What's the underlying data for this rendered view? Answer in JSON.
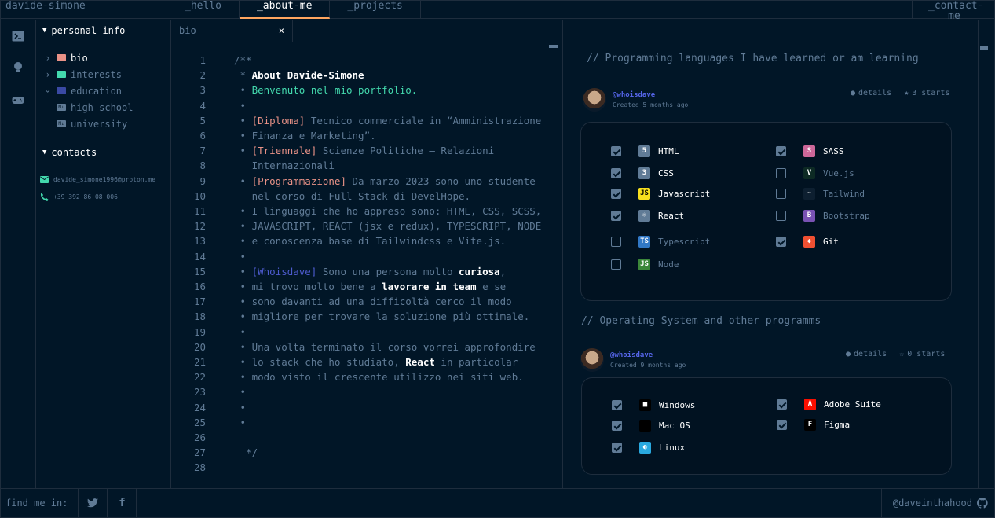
{
  "header": {
    "brand": "davide-simone",
    "tabs": [
      "_hello",
      "_about-me",
      "_projects"
    ],
    "active_tab": "_about-me",
    "contact": "_contact-me"
  },
  "sidebar": {
    "section_title": "personal-info",
    "items": [
      {
        "label": "bio",
        "type": "folder",
        "color": "#e99287",
        "active": true
      },
      {
        "label": "interests",
        "type": "folder",
        "color": "#43d9ad"
      },
      {
        "label": "education",
        "type": "folder",
        "color": "#3a49a4",
        "open": true
      },
      {
        "label": "high-school",
        "type": "file"
      },
      {
        "label": "university",
        "type": "file"
      }
    ],
    "contacts_title": "contacts",
    "email": "davide_simone1996@proton.me",
    "phone": "+39 392 86 08 006"
  },
  "editor": {
    "tab": "bio",
    "close": "×",
    "line_numbers": [
      "1",
      "2",
      "3",
      "4",
      "5",
      "6",
      "7",
      "8",
      "9",
      "10",
      "11",
      "12",
      "13",
      "14",
      "15",
      "16",
      "17",
      "18",
      "19",
      "20",
      "21",
      "22",
      "23",
      "24",
      "25",
      "26",
      "27",
      "28"
    ],
    "lines": [
      {
        "parts": [
          {
            "t": "/**"
          }
        ]
      },
      {
        "parts": [
          {
            "t": " * "
          },
          {
            "t": "About Davide-Simone",
            "c": "wb"
          }
        ]
      },
      {
        "parts": [
          {
            "t": " • "
          },
          {
            "t": "Benvenuto nel mio portfolio.",
            "c": "gr"
          }
        ]
      },
      {
        "parts": [
          {
            "t": " •"
          }
        ]
      },
      {
        "parts": [
          {
            "t": " • "
          },
          {
            "t": "[Diploma]",
            "c": "kw"
          },
          {
            "t": " Tecnico commerciale in “Amministrazione"
          }
        ]
      },
      {
        "parts": [
          {
            "t": " • Finanza e Marketing”."
          }
        ]
      },
      {
        "parts": [
          {
            "t": " • "
          },
          {
            "t": "[Triennale]",
            "c": "kw"
          },
          {
            "t": " Scienze Politiche – Relazioni"
          }
        ]
      },
      {
        "parts": [
          {
            "t": "   Internazionali"
          }
        ]
      },
      {
        "parts": [
          {
            "t": " • "
          },
          {
            "t": "[Programmazione]",
            "c": "kw"
          },
          {
            "t": " Da marzo 2023 sono uno studente"
          }
        ]
      },
      {
        "parts": [
          {
            "t": "   nel corso di Full Stack di DevelHope."
          }
        ]
      },
      {
        "parts": [
          {
            "t": " • I linguaggi che ho appreso sono: HTML, CSS, SCSS,"
          }
        ]
      },
      {
        "parts": [
          {
            "t": " • JAVASCRIPT, REACT (jsx e redux), TYPESCRIPT, NODE"
          }
        ]
      },
      {
        "parts": [
          {
            "t": " • e conoscenza base di Tailwindcss e Vite.js."
          }
        ]
      },
      {
        "parts": [
          {
            "t": " •"
          }
        ]
      },
      {
        "parts": [
          {
            "t": " • "
          },
          {
            "t": "[Whoisdave]",
            "c": "bl"
          },
          {
            "t": " Sono una persona molto "
          },
          {
            "t": "curiosa",
            "c": "wb"
          },
          {
            "t": ","
          }
        ]
      },
      {
        "parts": [
          {
            "t": " • mi trovo molto bene a "
          },
          {
            "t": "lavorare in team",
            "c": "wb"
          },
          {
            "t": " e se"
          }
        ]
      },
      {
        "parts": [
          {
            "t": " • sono davanti ad una difficoltà cerco il modo"
          }
        ]
      },
      {
        "parts": [
          {
            "t": " • migliore per trovare la soluzione più ottimale."
          }
        ]
      },
      {
        "parts": [
          {
            "t": " •"
          }
        ]
      },
      {
        "parts": [
          {
            "t": " • Una volta terminato il corso vorrei approfondire"
          }
        ]
      },
      {
        "parts": [
          {
            "t": " • lo stack che ho studiato, "
          },
          {
            "t": "React",
            "c": "wb"
          },
          {
            "t": " in particolar"
          }
        ]
      },
      {
        "parts": [
          {
            "t": " • modo visto il crescente utilizzo nei siti web."
          }
        ]
      },
      {
        "parts": [
          {
            "t": " •"
          }
        ]
      },
      {
        "parts": [
          {
            "t": " •"
          }
        ]
      },
      {
        "parts": [
          {
            "t": " •"
          }
        ]
      },
      {
        "parts": [
          {
            "t": ""
          }
        ]
      },
      {
        "parts": [
          {
            "t": "  */"
          }
        ]
      },
      {
        "parts": [
          {
            "t": ""
          }
        ]
      }
    ]
  },
  "right": {
    "section1_title": "// Programming languages I have learned or am learning",
    "profile1": {
      "name": "@whoisdave",
      "created": "Created 5 months ago",
      "details": "details",
      "stars": "3 starts"
    },
    "skills1": [
      {
        "label": "HTML",
        "checked": true,
        "icon": "html-icon",
        "color": "#607b96",
        "glyph": "5"
      },
      {
        "label": "SASS",
        "checked": true,
        "icon": "sass-icon",
        "color": "#cd6799",
        "glyph": "S"
      },
      {
        "label": "CSS",
        "checked": true,
        "icon": "css-icon",
        "color": "#607b96",
        "glyph": "3"
      },
      {
        "label": "Vue.js",
        "checked": false,
        "icon": "vue-icon",
        "color": "#0d2a24",
        "glyph": "V"
      },
      {
        "label": "Javascript",
        "checked": true,
        "icon": "javascript-icon",
        "color": "#f7df1e",
        "glyph": "JS"
      },
      {
        "label": "Tailwind",
        "checked": false,
        "icon": "tailwind-icon",
        "color": "#0d1f30",
        "glyph": "~"
      },
      {
        "label": "React",
        "checked": true,
        "icon": "react-icon",
        "color": "#607b96",
        "glyph": "⚛"
      },
      {
        "label": "Bootstrap",
        "checked": false,
        "icon": "bootstrap-icon",
        "color": "#7952b3",
        "glyph": "B"
      },
      {
        "label": "Typescript",
        "checked": false,
        "icon": "typescript-icon",
        "color": "#3178c6",
        "glyph": "TS"
      },
      {
        "label": "Git",
        "checked": true,
        "icon": "git-icon",
        "color": "#f05032",
        "glyph": "◆"
      },
      {
        "label": "Node",
        "checked": false,
        "icon": "node-icon",
        "color": "#3c873a",
        "glyph": "JS"
      }
    ],
    "section2_title": "// Operating System and other programms",
    "profile2": {
      "name": "@whoisdave",
      "created": "Created 9 months ago",
      "details": "details",
      "stars": "0 starts"
    },
    "skills2": [
      {
        "label": "Windows",
        "checked": true,
        "icon": "windows-icon",
        "color": "#000000",
        "glyph": "■"
      },
      {
        "label": "Adobe Suite",
        "checked": true,
        "icon": "adobe-icon",
        "color": "#fa0f00",
        "glyph": "A"
      },
      {
        "label": "Mac OS",
        "checked": true,
        "icon": "apple-icon",
        "color": "#000000",
        "glyph": ""
      },
      {
        "label": "Figma",
        "checked": true,
        "icon": "figma-icon",
        "color": "#000000",
        "glyph": "F"
      },
      {
        "label": "Linux",
        "checked": true,
        "icon": "linux-icon",
        "color": "#29a9df",
        "glyph": "◐"
      }
    ]
  },
  "footer": {
    "find_me": "find me in:",
    "twitter": "twitter-icon",
    "facebook": "facebook-icon",
    "github_user": "@daveinthahood"
  },
  "colors": {
    "bg": "#011627",
    "border": "#1e2d3d",
    "accent": "#fea55f",
    "muted": "#607b96",
    "green": "#43d9ad"
  }
}
